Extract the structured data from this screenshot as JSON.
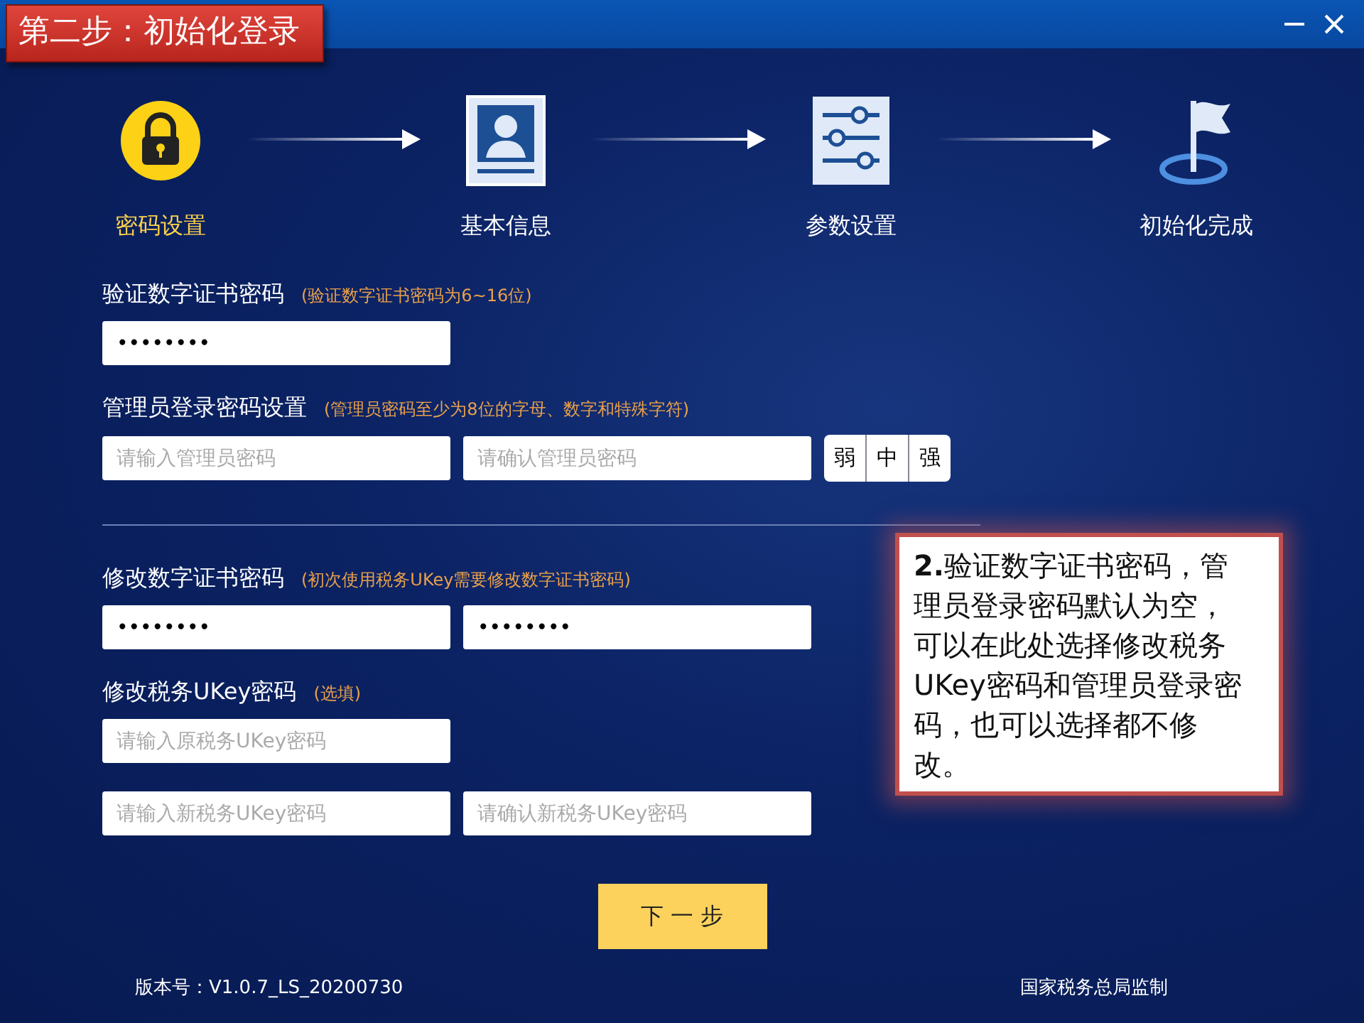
{
  "window": {
    "title": "第二步：初始化登录"
  },
  "steps": [
    {
      "label": "密码设置",
      "selected": true,
      "kind": "lock"
    },
    {
      "label": "基本信息",
      "selected": false,
      "kind": "profile"
    },
    {
      "label": "参数设置",
      "selected": false,
      "kind": "sliders"
    },
    {
      "label": "初始化完成",
      "selected": false,
      "kind": "flag"
    }
  ],
  "sections": [
    {
      "label": "验证数字证书密码",
      "hint": "(验证数字证书密码为6~16位)",
      "fields": [
        {
          "value": "••••••••"
        }
      ]
    },
    {
      "label": "管理员登录密码设置",
      "hint": "(管理员密码至少为8位的字母、数字和特殊字符)",
      "fields": [
        {
          "placeholder": "请输入管理员密码"
        },
        {
          "placeholder": "请确认管理员密码"
        }
      ],
      "strength": [
        "弱",
        "中",
        "强"
      ]
    },
    {
      "label": "修改数字证书密码",
      "hint": "(初次使用税务UKey需要修改数字证书密码)",
      "divider_before": true,
      "fields": [
        {
          "value": "••••••••"
        },
        {
          "value": "••••••••"
        }
      ]
    },
    {
      "label": "修改税务UKey密码",
      "hint": "(选填)",
      "fields": [
        {
          "placeholder": "请输入原税务UKey密码"
        }
      ]
    },
    {
      "fields": [
        {
          "placeholder": "请输入新税务UKey密码"
        },
        {
          "placeholder": "请确认新税务UKey密码"
        }
      ]
    }
  ],
  "callout": {
    "text": "**2.**验证数字证书密码，管理员登录密码默认为空，可以在此处选择修改税务UKey密码和管理员登录密码，也可以选择都不修改。"
  },
  "next_button": "下 一 步",
  "footer": {
    "version": "版本号：V1.0.7_LS_20200730",
    "supervisor": "国家税务总局监制"
  }
}
